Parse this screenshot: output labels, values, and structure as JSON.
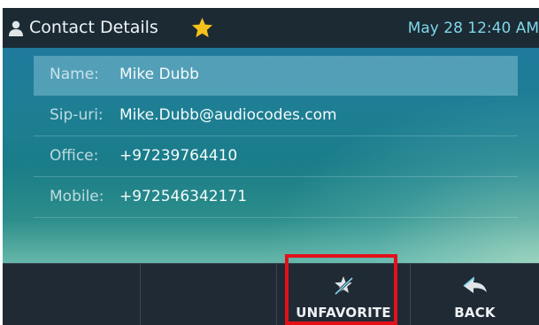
{
  "header": {
    "title": "Contact Details",
    "datetime": "May 28 12:40 AM",
    "icons": {
      "contact": "person-icon",
      "favorite": "star-icon"
    },
    "colors": {
      "star": "#f6c21a",
      "clock": "#7fd6ea"
    }
  },
  "contact": {
    "fields": [
      {
        "label": "Name:",
        "value": "Mike Dubb"
      },
      {
        "label": "Sip-uri:",
        "value": "Mike.Dubb@audiocodes.com"
      },
      {
        "label": "Office:",
        "value": "+97239764410"
      },
      {
        "label": "Mobile:",
        "value": "+972546342171"
      }
    ]
  },
  "softkeys": [
    {
      "label": "",
      "icon": ""
    },
    {
      "label": "",
      "icon": ""
    },
    {
      "label": "UNFAVORITE",
      "icon": "unfavorite-star-icon"
    },
    {
      "label": "BACK",
      "icon": "back-arrow-icon"
    }
  ],
  "annotation": {
    "highlight_color": "#e3101a"
  }
}
